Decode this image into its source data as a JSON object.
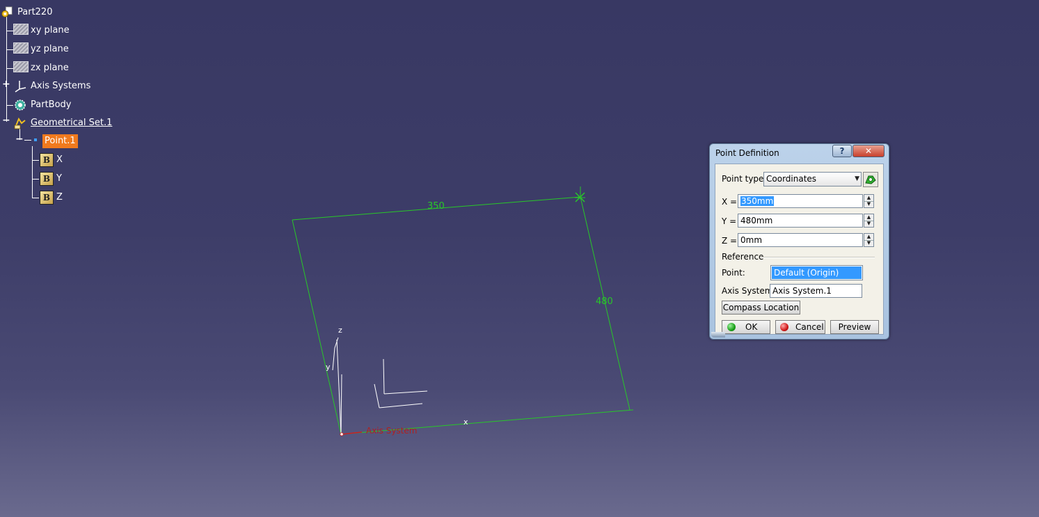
{
  "tree": {
    "root_label": "Part220",
    "xy_plane": "xy plane",
    "yz_plane": "yz plane",
    "zx_plane": "zx plane",
    "axis_systems": "Axis Systems",
    "part_body": "PartBody",
    "geometrical_set": "Geometrical Set.1",
    "point": "Point.1",
    "param_x": "X",
    "param_y": "Y",
    "param_z": "Z"
  },
  "viewport": {
    "dimension_x": "350",
    "dimension_y": "480",
    "axis_x": "x",
    "axis_y": "y",
    "axis_z": "z",
    "axis_system_name": "Axis System",
    "line_color": "#28c828",
    "axis_color": "#ffffff",
    "origin_color": "#cc2020"
  },
  "dialog": {
    "title": "Point Definition",
    "help_label": "?",
    "close_label": "✕",
    "point_type_label": "Point type:",
    "point_type_value": "Coordinates",
    "x_label": "X =",
    "x_value": "350mm",
    "y_label": "Y =",
    "y_value": "480mm",
    "z_label": "Z =",
    "z_value": "0mm",
    "reference_label": "Reference",
    "point_label": "Point:",
    "point_value": "Default (Origin)",
    "axis_system_label": "Axis System:",
    "axis_system_value": "Axis System.1",
    "compass_label": "Compass Location",
    "ok_label": "OK",
    "cancel_label": "Cancel",
    "preview_label": "Preview"
  }
}
